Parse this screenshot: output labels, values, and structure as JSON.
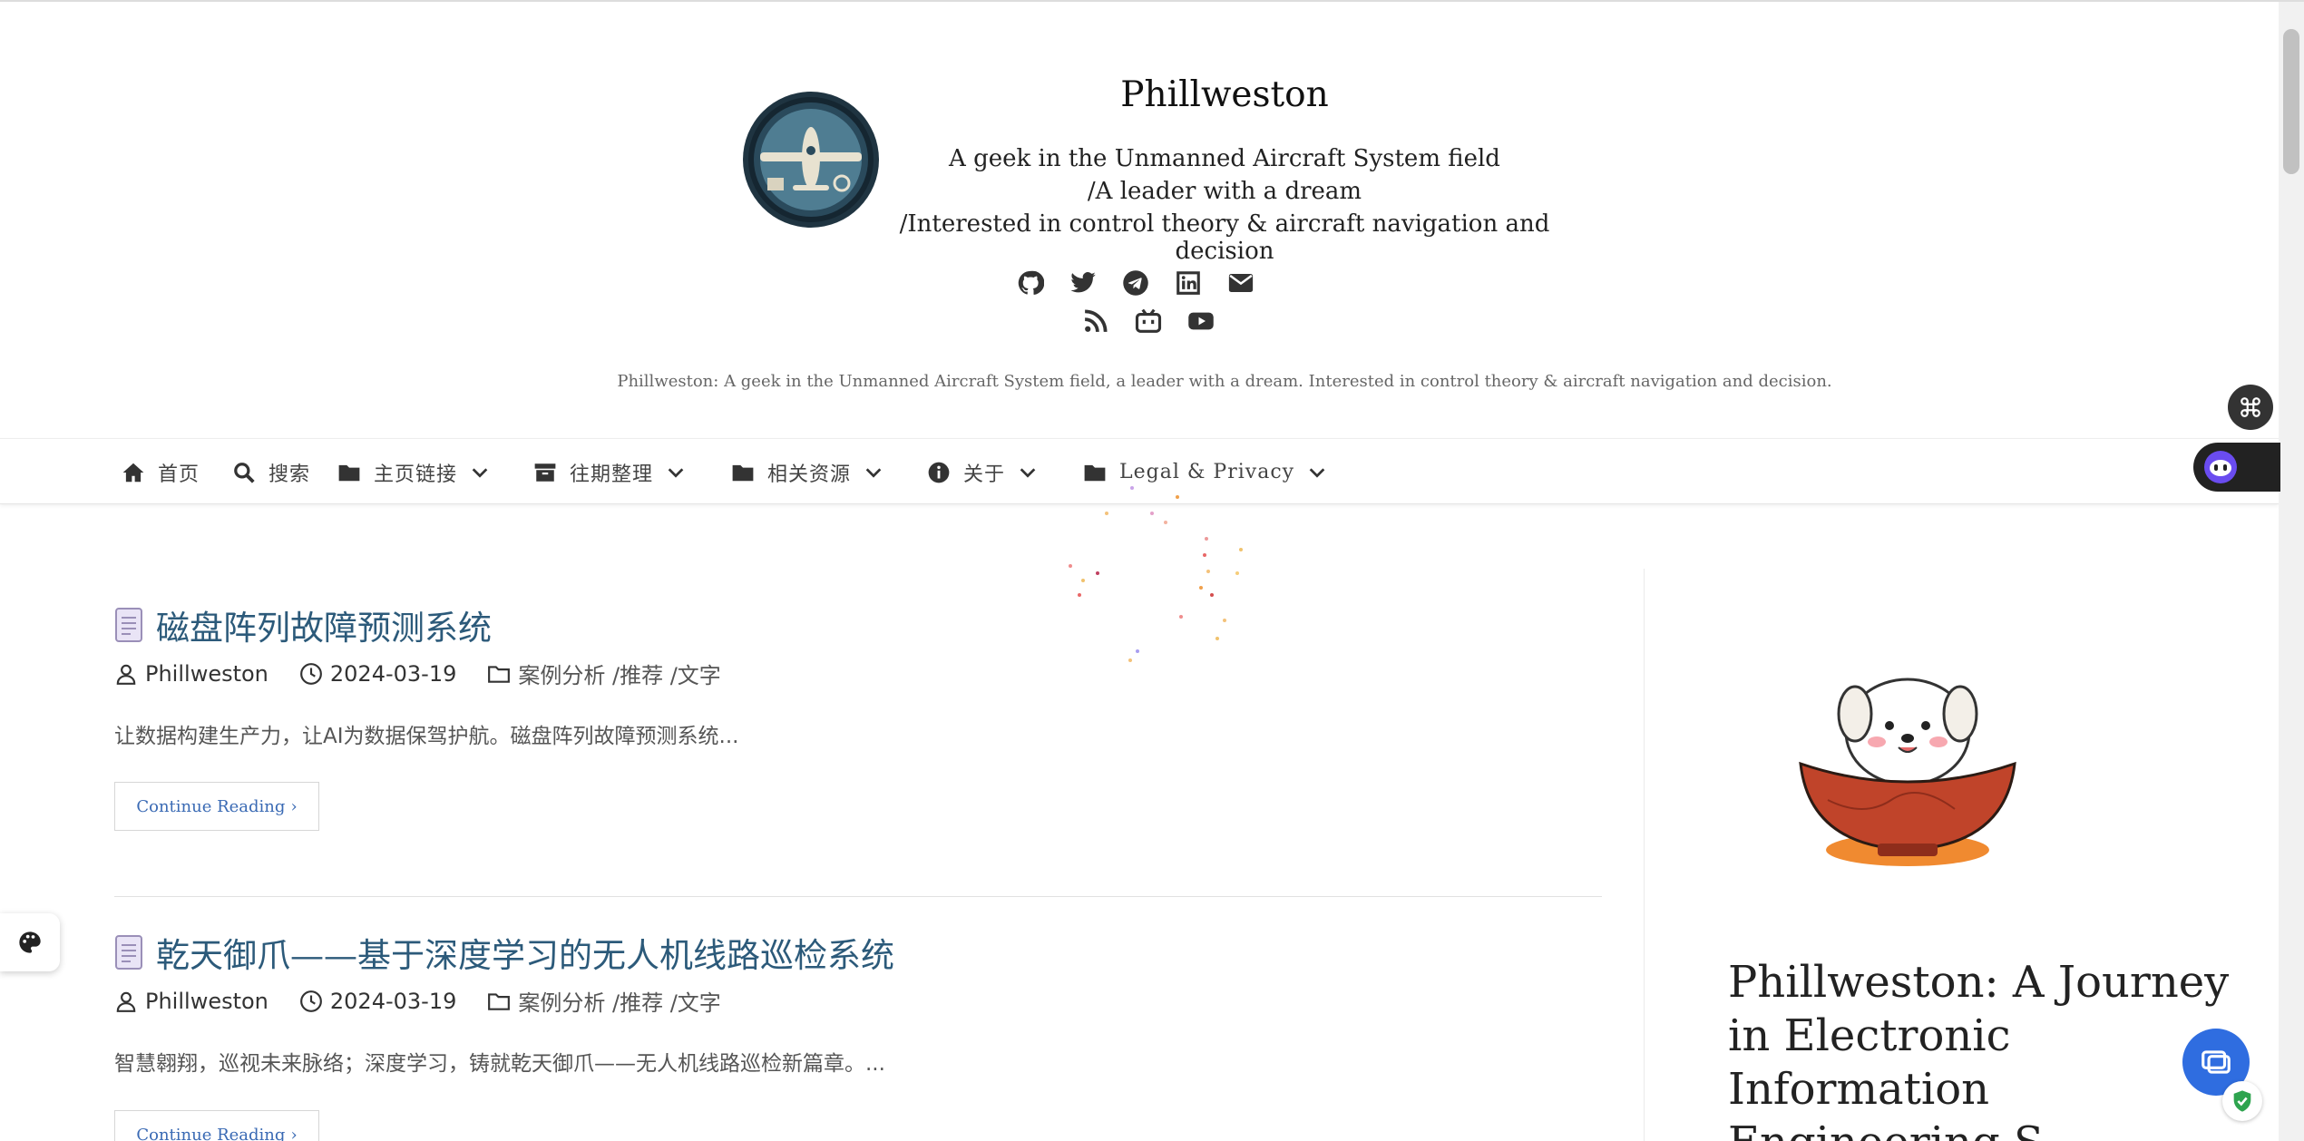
{
  "site": {
    "title": "Phillweston",
    "tagline_lines": [
      "A geek in the Unmanned Aircraft System field",
      "/A leader with a dream",
      "/Interested in control theory & aircraft navigation and decision"
    ],
    "description": "Phillweston: A geek in the Unmanned Aircraft System field, a leader with a dream. Interested in control theory & aircraft navigation and decision."
  },
  "social_icons": [
    "github-icon",
    "twitter-icon",
    "telegram-icon",
    "linkedin-icon",
    "email-icon",
    "rss-icon",
    "bilibili-icon",
    "youtube-icon"
  ],
  "nav": [
    {
      "label": "首页",
      "icon": "home-icon",
      "dropdown": false
    },
    {
      "label": "搜索",
      "icon": "search-icon",
      "dropdown": false
    },
    {
      "label": "主页链接",
      "icon": "folder-icon",
      "dropdown": true
    },
    {
      "label": "往期整理",
      "icon": "archive-icon",
      "dropdown": true
    },
    {
      "label": "相关资源",
      "icon": "folder-icon",
      "dropdown": true
    },
    {
      "label": "关于",
      "icon": "info-icon",
      "dropdown": true
    },
    {
      "label": "Legal & Privacy",
      "icon": "folder-icon",
      "dropdown": true
    }
  ],
  "posts": [
    {
      "title": "磁盘阵列故障预测系统",
      "author": "Phillweston",
      "date": "2024-03-19",
      "categories": "案例分析  /推荐 /文字",
      "excerpt": "让数据构建生产力，让AI为数据保驾护航。磁盘阵列故障预测系统...",
      "read_more": "Continue Reading"
    },
    {
      "title": "乾天御爪——基于深度学习的无人机线路巡检系统",
      "author": "Phillweston",
      "date": "2024-03-19",
      "categories": "案例分析  /推荐 /文字",
      "excerpt": "智慧翱翔，巡视未来脉络；深度学习，铸就乾天御爪——无人机线路巡检新篇章。...",
      "read_more": "Continue Reading"
    }
  ],
  "sidebar": {
    "heading": "Phillweston: A Journey in Electronic Information Engineering S..."
  },
  "colors": {
    "title_link": "#2c5a7a",
    "read_more": "#3a6ab4",
    "chat_button": "#2f6de0",
    "logo_bg": "#1f3441"
  }
}
